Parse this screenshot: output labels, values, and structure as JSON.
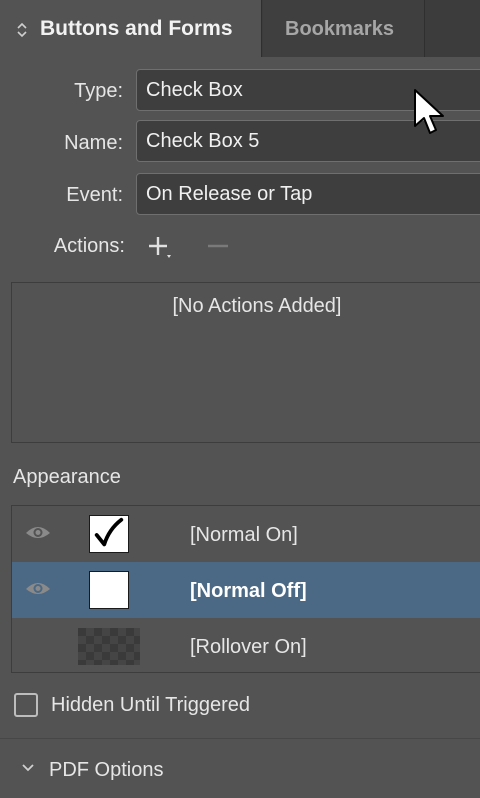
{
  "tabs": {
    "active_label": "Buttons and Forms",
    "inactive_label": "Bookmarks"
  },
  "fields": {
    "type": {
      "label": "Type:",
      "value": "Check Box"
    },
    "name": {
      "label": "Name:",
      "value": "Check Box 5"
    },
    "event": {
      "label": "Event:",
      "value": "On Release or Tap"
    }
  },
  "actions": {
    "label": "Actions:",
    "empty_text": "[No Actions Added]",
    "add_icon": "plus-icon",
    "remove_icon": "minus-icon"
  },
  "appearance": {
    "label": "Appearance",
    "rows": [
      {
        "label": "[Normal On]",
        "thumbnail": "checkmark",
        "visible_eye": true,
        "selected": false
      },
      {
        "label": "[Normal Off]",
        "thumbnail": "blank",
        "visible_eye": true,
        "selected": true
      },
      {
        "label": "[Rollover On]",
        "thumbnail": "transparent",
        "visible_eye": false,
        "selected": false
      }
    ]
  },
  "hidden_until_triggered": {
    "label": "Hidden Until Triggered",
    "checked": false
  },
  "pdf_options": {
    "label": "PDF Options",
    "expanded": false
  },
  "colors": {
    "panel_bg": "#535353",
    "selected_row": "#4b6984",
    "field_bg": "#3e3e3e"
  }
}
